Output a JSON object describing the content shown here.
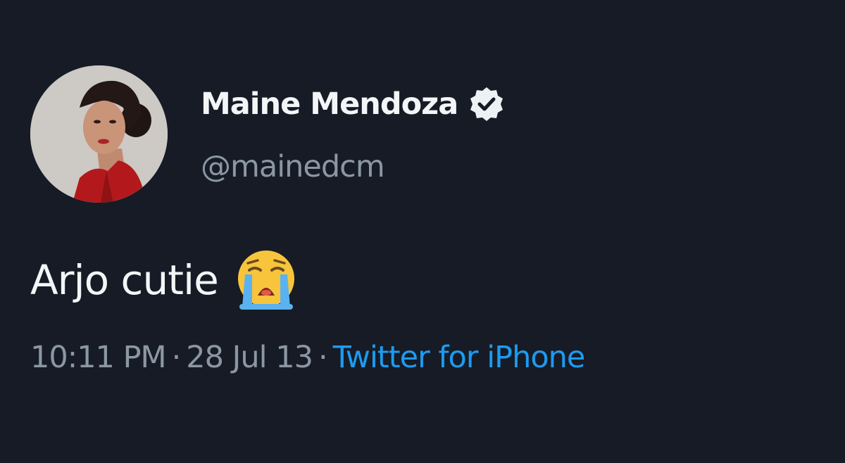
{
  "user": {
    "display_name": "Maine Mendoza",
    "handle": "@mainedcm",
    "verified": true,
    "avatar": "profile-photo"
  },
  "tweet": {
    "text": "Arjo cutie",
    "emoji": "loudly-crying-face-icon"
  },
  "meta": {
    "time": "10:11 PM",
    "separator": "·",
    "date": "28 Jul 13",
    "source": "Twitter for iPhone"
  },
  "colors": {
    "background": "#161b26",
    "primary_text": "#f3f5f7",
    "secondary_text": "#8c97a4",
    "link": "#1d9bf0"
  }
}
